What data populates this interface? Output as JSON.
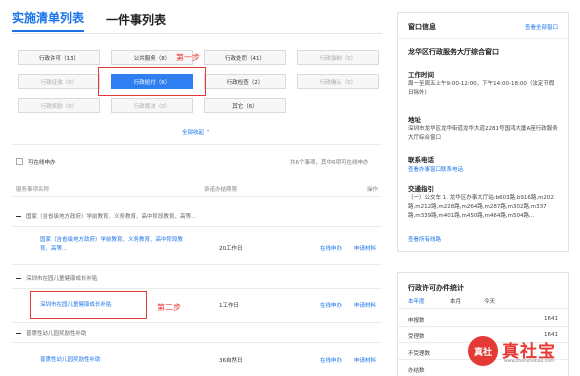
{
  "tabs": [
    {
      "label": "实施清单列表",
      "active": true
    },
    {
      "label": "一件事列表",
      "active": false
    }
  ],
  "categories": [
    {
      "label": "行政许可（13）",
      "state": "normal"
    },
    {
      "label": "公共服务（8）",
      "state": "normal"
    },
    {
      "label": "行政处罚（41）",
      "state": "normal"
    },
    {
      "label": "行政强制（0）",
      "state": "dim"
    },
    {
      "label": "行政征收（0）",
      "state": "dim"
    },
    {
      "label": "行政给付（6）",
      "state": "active"
    },
    {
      "label": "行政检查（2）",
      "state": "normal"
    },
    {
      "label": "行政确认（0）",
      "state": "dim"
    },
    {
      "label": "行政奖励（0）",
      "state": "dim"
    },
    {
      "label": "行政裁决（0）",
      "state": "dim"
    },
    {
      "label": "其它（6）",
      "state": "normal"
    }
  ],
  "annotations": {
    "step1": "第一步",
    "step2": "第二步"
  },
  "collapse_label": "全部收起 ⌃",
  "filter": {
    "checkbox_label": "可在线申办",
    "count_text": "共6个事项，其中6项可在线申办"
  },
  "table": {
    "headers": [
      "服务事项名称",
      "承诺办结期限",
      "操作"
    ],
    "groups": [
      {
        "title": "国家（含省级地方政府）学前教育、义务教育、高中阶段教育、高等...",
        "items": [
          {
            "name": "国家（含省级地方政府）学前教育、义务教育、高中阶段教育、高等...",
            "time": "20工作日",
            "online": "在线申办",
            "material": "申请材料"
          }
        ]
      },
      {
        "title": "深圳市在园儿童健康成长补贴",
        "items": [
          {
            "name": "深圳市在园儿童健康成长补贴",
            "time": "1工作日",
            "online": "在线申办",
            "material": "申请材料"
          }
        ]
      },
      {
        "title": "普惠性幼儿园奖励性补助",
        "items": [
          {
            "name": "普惠性幼儿园奖励性补助",
            "time": "36自然日",
            "online": "在线申办",
            "material": "申请材料"
          }
        ]
      }
    ]
  },
  "window_info": {
    "title": "窗口信息",
    "link": "查看全部窗口",
    "name": "龙华区行政服务大厅综合窗口",
    "hours_title": "工作时间",
    "hours": "周一至周五上午9:00-12:00，下午14:00-18:00（法定节假日除外）",
    "address_title": "地址",
    "address": "深圳市龙华区龙华街道龙华大道2281号国鸿大厦A座行政服务大厅综合窗口",
    "phone_title": "联系电话",
    "phone_link": "查看办事窗口联系电话",
    "traffic_title": "交通指引",
    "traffic": "（一）公交车 1. 龙华区办事大厅站:b603路,b916路,m202路,m212路,m228路,m264路,m287路,m302路,m337路,m339路,m401路,m450路,m464路,m504路...",
    "traffic_link": "查看所有线路"
  },
  "stats": {
    "title": "行政许可办件统计",
    "tabs": [
      {
        "label": "本年度",
        "active": true
      },
      {
        "label": "本月",
        "active": false
      },
      {
        "label": "今天",
        "active": false
      }
    ],
    "rows": [
      {
        "label": "申报数",
        "value": "1641"
      },
      {
        "label": "受理数",
        "value": "1641"
      },
      {
        "label": "不受理数",
        "value": ""
      },
      {
        "label": "办结数",
        "value": ""
      }
    ]
  },
  "watermark": {
    "badge": "真社",
    "name": "真社宝",
    "url": "www.zhenshebao.com"
  }
}
